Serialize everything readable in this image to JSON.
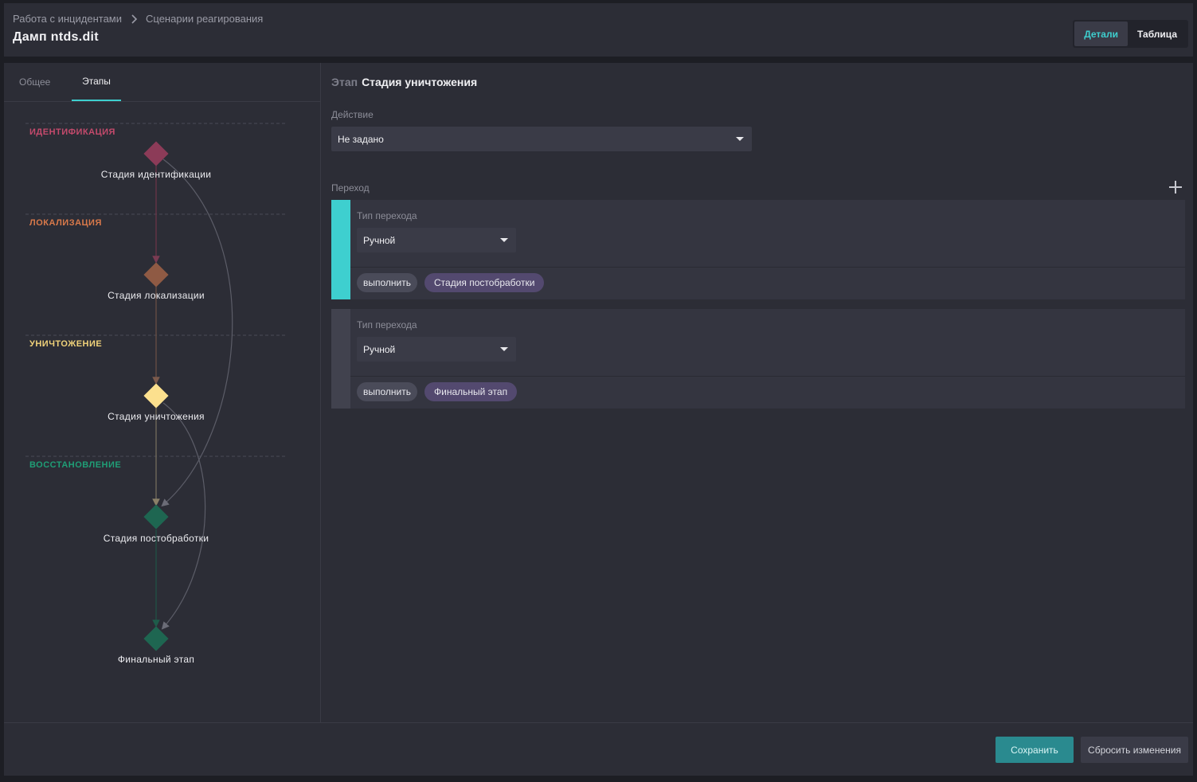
{
  "breadcrumb": {
    "root": "Работа с инцидентами",
    "current": "Сценарии реагирования"
  },
  "page": {
    "title": "Дамп ntds.dit"
  },
  "view_toggle": {
    "details": "Детали",
    "table": "Таблица"
  },
  "left_tabs": {
    "general": "Общее",
    "stages": "Этапы"
  },
  "graph": {
    "phases": [
      {
        "label": "ИДЕНТИФИКАЦИЯ",
        "color": "#c44a6c"
      },
      {
        "label": "ЛОКАЛИЗАЦИЯ",
        "color": "#d9794a"
      },
      {
        "label": "УНИЧТОЖЕНИЕ",
        "color": "#f0d27a"
      },
      {
        "label": "ВОССТАНОВЛЕНИЕ",
        "color": "#1f9e76"
      }
    ],
    "nodes": [
      {
        "label": "Стадия идентификации",
        "color": "#8c3b58"
      },
      {
        "label": "Стадия локализации",
        "color": "#8f5a44"
      },
      {
        "label": "Стадия уничтожения",
        "color": "#fce08e"
      },
      {
        "label": "Стадия постобработки",
        "color": "#1e6651"
      },
      {
        "label": "Финальный этап",
        "color": "#1e6651"
      }
    ]
  },
  "stage": {
    "prefix": "Этап",
    "name": "Стадия уничтожения"
  },
  "action": {
    "label": "Действие",
    "value": "Не задано"
  },
  "transitions": {
    "label": "Переход",
    "items": [
      {
        "type_label": "Тип перехода",
        "type_value": "Ручной",
        "action_chip": "выполнить",
        "target_chip": "Стадия постобработки",
        "strip_color": "#3ecfcf"
      },
      {
        "type_label": "Тип перехода",
        "type_value": "Ручной",
        "action_chip": "выполнить",
        "target_chip": "Финальный этап",
        "strip_color": "#41424e"
      }
    ]
  },
  "footer": {
    "save": "Сохранить",
    "reset": "Сбросить изменения"
  }
}
